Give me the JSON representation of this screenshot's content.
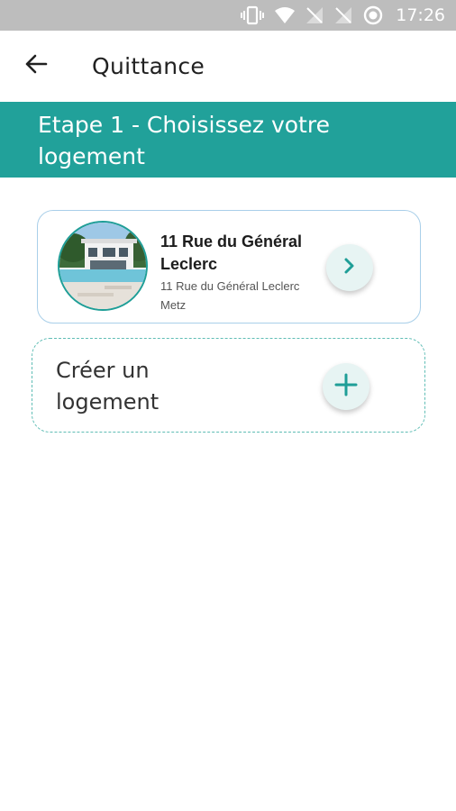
{
  "status_bar": {
    "time": "17:26",
    "icons": [
      "vibrate-icon",
      "wifi-icon",
      "signal-off-icon",
      "signal-off-icon",
      "sync-circle-icon"
    ]
  },
  "app_bar": {
    "back_icon": "arrow-left-icon",
    "title": "Quittance"
  },
  "step": {
    "title": "Etape 1 - Choisissez votre logement"
  },
  "housing": {
    "name": "11 Rue du Général Leclerc",
    "address_line": "11 Rue du Général Leclerc",
    "city": "Metz",
    "photo_icon": "house-photo",
    "action_icon": "chevron-right-icon"
  },
  "create": {
    "label": "Créer un logement",
    "action_icon": "plus-icon"
  },
  "colors": {
    "accent": "#21a19a",
    "status_bar": "#bdbdbd",
    "card_border": "#a9cfe9",
    "dashed_border": "#5fbdb5",
    "button_bg": "#e7f4f3"
  }
}
